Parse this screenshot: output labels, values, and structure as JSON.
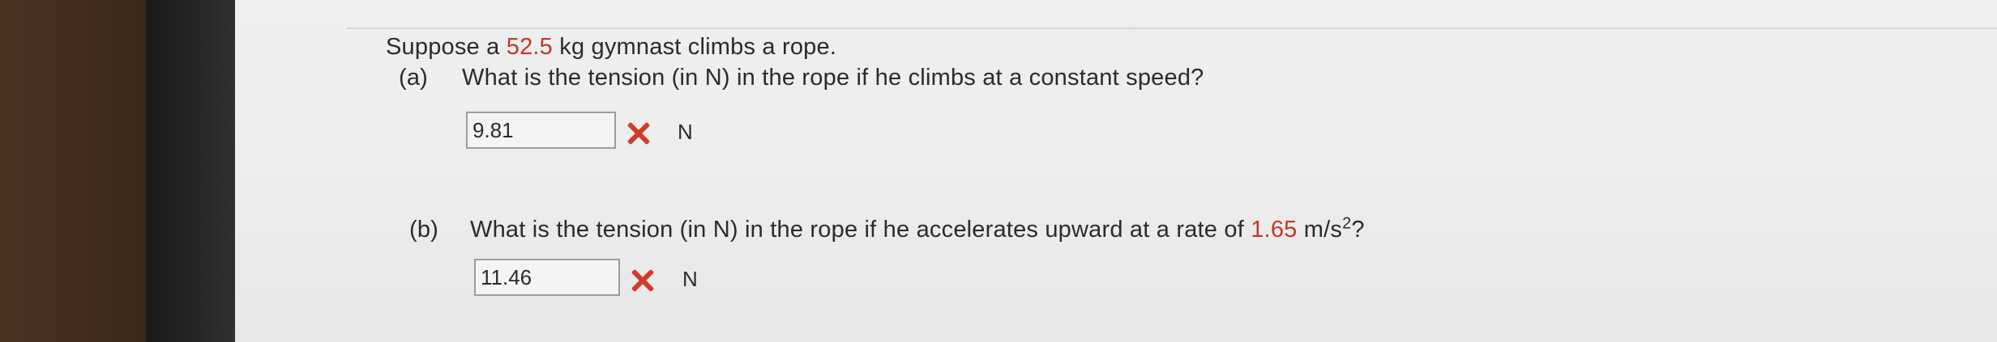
{
  "problem": {
    "intro_before": "Suppose a ",
    "mass_value": "52.5",
    "intro_after": " kg gymnast climbs a rope."
  },
  "part_a": {
    "marker": "(a)",
    "question": "What is the tension (in N) in the rope if he climbs at a constant speed?",
    "answer_value": "9.81",
    "answer_status": "incorrect",
    "status_icon": "x-icon",
    "unit": "N"
  },
  "part_b": {
    "marker": "(b)",
    "question_before": "What is the tension (in N) in the rope if he accelerates upward at a rate of ",
    "accel_value": "1.65",
    "accel_unit_base": " m/s",
    "accel_unit_exp": "2",
    "question_after": "?",
    "answer_value": "11.46",
    "answer_status": "incorrect",
    "status_icon": "x-icon",
    "unit": "N"
  },
  "colors": {
    "highlight": "#c0392b",
    "incorrect": "#d23a2a",
    "text": "#2b2b2b",
    "background": "#ededed"
  }
}
